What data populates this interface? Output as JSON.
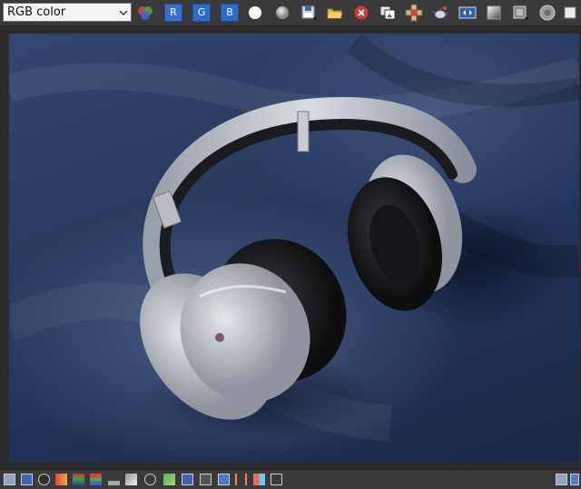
{
  "toolbar": {
    "channel_select": {
      "selected": "RGB color"
    },
    "channel_buttons": [
      {
        "label": "R",
        "icon": "red-channel"
      },
      {
        "label": "G",
        "icon": "green-channel"
      },
      {
        "label": "B",
        "icon": "blue-channel"
      }
    ],
    "tools": [
      "enable-color-channels-icon",
      "white-display-icon",
      "grey-display-icon",
      "save-image-icon",
      "open-folder-icon",
      "clear-icon",
      "copy-image-icon",
      "render-region-icon",
      "teapot-render-icon",
      "frame-buffer-icon",
      "toggle-alpha-icon",
      "display-options-icon",
      "spinner-icon"
    ]
  },
  "viewport": {
    "content": "rendered-headphones-image"
  },
  "statusbar": {
    "icons": [
      "frame-icon",
      "layers-icon",
      "info-icon",
      "color-icon",
      "hsl-icon",
      "levels-icon",
      "histogram-icon",
      "curves-icon",
      "lens-icon",
      "exposure-icon",
      "image-icon",
      "lut-icon",
      "panel-icon",
      "compare-icon",
      "stereo-icon",
      "settings-icon"
    ],
    "right_icons": [
      "toggle-panel-icon",
      "maximize-icon"
    ]
  },
  "colors": {
    "toolbar_bg": "#3a3a3a",
    "channel_blue": "#2d6cc9",
    "viewport_blue": "#2a3b60"
  }
}
